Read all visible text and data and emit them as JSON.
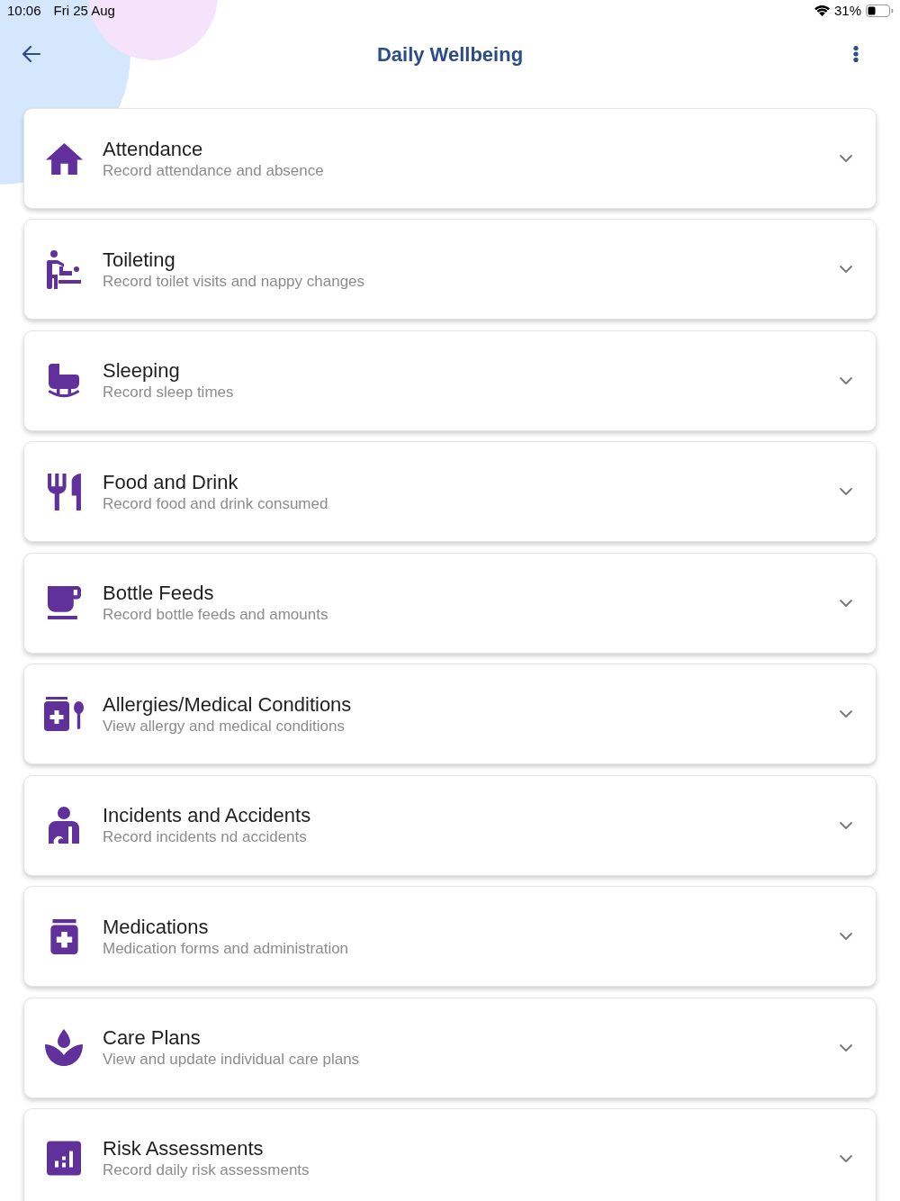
{
  "status_bar": {
    "time": "10:06",
    "date": "Fri 25 Aug",
    "battery": "31%"
  },
  "header": {
    "title": "Daily Wellbeing"
  },
  "sections": [
    {
      "title": "Attendance",
      "subtitle": "Record attendance and absence",
      "expanded": false
    },
    {
      "title": "Toileting",
      "subtitle": "Record toilet visits and nappy changes",
      "expanded": false
    },
    {
      "title": "Sleeping",
      "subtitle": "Record sleep times",
      "expanded": false
    },
    {
      "title": "Food and Drink",
      "subtitle": "Record food and drink consumed",
      "expanded": false
    },
    {
      "title": "Bottle Feeds",
      "subtitle": "Record bottle feeds and amounts",
      "expanded": false
    },
    {
      "title": "Allergies/Medical Conditions",
      "subtitle": "View allergy and medical conditions",
      "expanded": false
    },
    {
      "title": "Incidents and Accidents",
      "subtitle": "Record incidents nd accidents",
      "expanded": false
    },
    {
      "title": "Medications",
      "subtitle": "Medication forms and administration",
      "expanded": false
    },
    {
      "title": "Care Plans",
      "subtitle": "View and update individual care plans",
      "expanded": false
    },
    {
      "title": "Risk Assessments",
      "subtitle": "Record daily risk assessments",
      "expanded": false
    }
  ]
}
